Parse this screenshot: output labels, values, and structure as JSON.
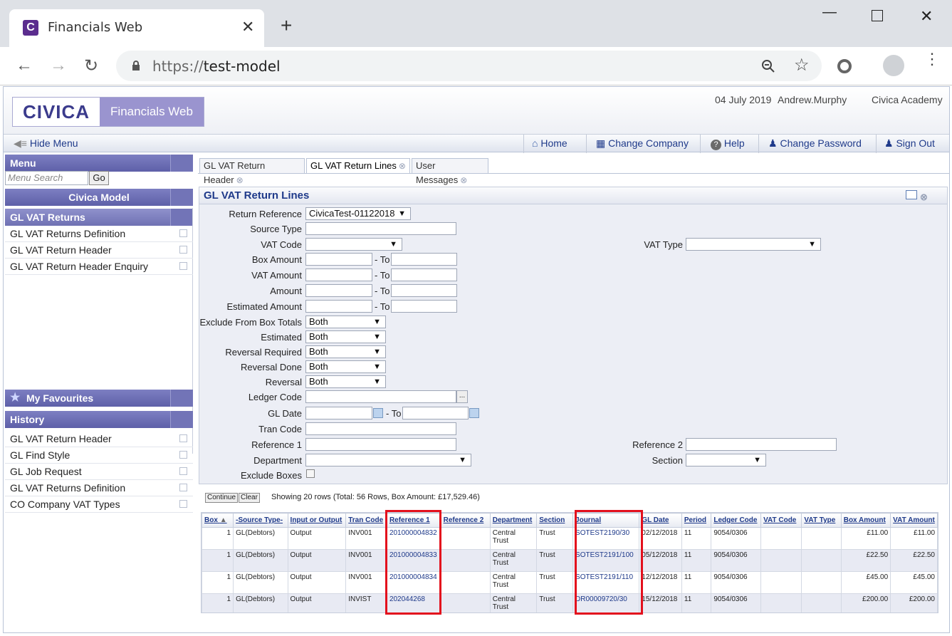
{
  "browser": {
    "tab_title": "Financials Web",
    "tab_close": "✕",
    "new_tab": "+",
    "url_prefix": "https://",
    "url_host": "test-model"
  },
  "header": {
    "logo_text": "CIVICA",
    "product": "Financials Web",
    "date": "04 July 2019",
    "user": "Andrew.Murphy",
    "company": "Civica Academy"
  },
  "toolbar": {
    "hide_menu": "Hide Menu",
    "home": "Home",
    "change_company": "Change Company",
    "help": "Help",
    "change_password": "Change Password",
    "sign_out": "Sign Out"
  },
  "sidebar": {
    "menu_title": "Menu",
    "search_placeholder": "Menu Search",
    "go": "Go",
    "model": "Civica Model",
    "section": "GL VAT Returns",
    "items": [
      "GL VAT Returns Definition",
      "GL VAT Return Header",
      "GL VAT Return Header Enquiry"
    ],
    "favourites": "My Favourites",
    "history_title": "History",
    "history": [
      "GL VAT Return Header",
      "GL Find Style",
      "GL Job Request",
      "GL VAT Returns Definition",
      "CO Company VAT Types"
    ]
  },
  "tabs": [
    "GL VAT Return Header",
    "GL VAT Return Lines",
    "User Messages"
  ],
  "panel": {
    "title": "GL VAT Return Lines",
    "labels": {
      "return_reference": "Return Reference",
      "source_type": "Source Type",
      "vat_code": "VAT Code",
      "vat_type": "VAT Type",
      "box_amount": "Box Amount",
      "vat_amount": "VAT Amount",
      "amount": "Amount",
      "estimated_amount": "Estimated Amount",
      "exclude_box_totals": "Exclude From Box Totals",
      "estimated": "Estimated",
      "reversal_required": "Reversal Required",
      "reversal_done": "Reversal Done",
      "reversal": "Reversal",
      "ledger_code": "Ledger Code",
      "gl_date": "GL Date",
      "tran_code": "Tran Code",
      "reference1": "Reference 1",
      "reference2": "Reference 2",
      "department": "Department",
      "section": "Section",
      "exclude_boxes": "Exclude Boxes",
      "to": "- To"
    },
    "return_reference_value": "CivicaTest-01122018",
    "both": "Both",
    "ellipsis": "..."
  },
  "actions": {
    "continue": "Continue",
    "clear": "Clear",
    "row_info": "Showing 20 rows (Total: 56 Rows, Box Amount: £17,529.46)"
  },
  "grid": {
    "columns": [
      "Box",
      "-Source Type-",
      "Input or Output",
      "Tran Code",
      "Reference 1",
      "Reference 2",
      "Department",
      "Section",
      "Journal",
      "GL Date",
      "Period",
      "Ledger Code",
      "VAT Code",
      "VAT Type",
      "Box Amount",
      "VAT Amount"
    ],
    "sort_indicator": "▲",
    "rows": [
      {
        "box": "1",
        "source": "GL(Debtors)",
        "io": "Output",
        "tran": "INV001",
        "ref1": "201000004832",
        "ref2": "",
        "dept1": "Central",
        "dept2": "Trust",
        "section": "Trust",
        "journal": "SOTEST2190/30",
        "gldate": "02/12/2018",
        "period": "11",
        "ledger": "9054/0306",
        "vatcode": "",
        "vattype": "",
        "boxamt": "£11.00",
        "vatamt": "£11.00"
      },
      {
        "box": "1",
        "source": "GL(Debtors)",
        "io": "Output",
        "tran": "INV001",
        "ref1": "201000004833",
        "ref2": "",
        "dept1": "Central",
        "dept2": "Trust",
        "section": "Trust",
        "journal": "SOTEST2191/100",
        "gldate": "05/12/2018",
        "period": "11",
        "ledger": "9054/0306",
        "vatcode": "",
        "vattype": "",
        "boxamt": "£22.50",
        "vatamt": "£22.50"
      },
      {
        "box": "1",
        "source": "GL(Debtors)",
        "io": "Output",
        "tran": "INV001",
        "ref1": "201000004834",
        "ref2": "",
        "dept1": "Central",
        "dept2": "Trust",
        "section": "Trust",
        "journal": "SOTEST2191/110",
        "gldate": "12/12/2018",
        "period": "11",
        "ledger": "9054/0306",
        "vatcode": "",
        "vattype": "",
        "boxamt": "£45.00",
        "vatamt": "£45.00"
      },
      {
        "box": "1",
        "source": "GL(Debtors)",
        "io": "Output",
        "tran": "INVIST",
        "ref1": "202044268",
        "ref2": "",
        "dept1": "Central",
        "dept2": "Trust",
        "section": "Trust",
        "journal": "DR00009720/30",
        "gldate": "15/12/2018",
        "period": "11",
        "ledger": "9054/0306",
        "vatcode": "",
        "vattype": "",
        "boxamt": "£200.00",
        "vatamt": "£200.00"
      }
    ]
  },
  "colors": {
    "accent": "#5e60a8",
    "link": "#1f3a8a",
    "highlight": "#e3101d"
  }
}
